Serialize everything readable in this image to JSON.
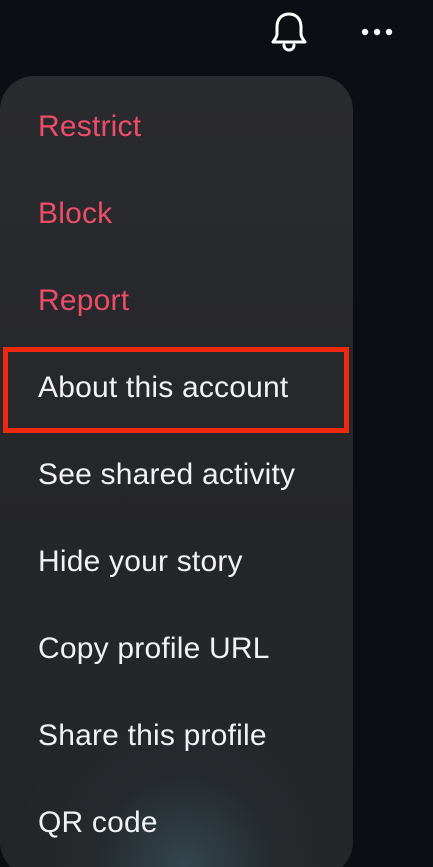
{
  "header": {
    "bell_icon": "bell-icon",
    "more_icon": "more-horizontal-icon"
  },
  "menu": {
    "items": [
      {
        "label": "Restrict",
        "style": "danger"
      },
      {
        "label": "Block",
        "style": "danger"
      },
      {
        "label": "Report",
        "style": "danger"
      },
      {
        "label": "About this account",
        "style": "normal",
        "highlighted": true
      },
      {
        "label": "See shared activity",
        "style": "normal"
      },
      {
        "label": "Hide your story",
        "style": "normal"
      },
      {
        "label": "Copy profile URL",
        "style": "normal"
      },
      {
        "label": "Share this profile",
        "style": "normal"
      },
      {
        "label": "QR code",
        "style": "normal"
      }
    ]
  },
  "colors": {
    "danger": "#ee4d69",
    "text": "#f2f2f4",
    "highlight": "#ef2a10",
    "menu_bg": "#2a2b2f",
    "page_bg": "#0b0e12"
  }
}
